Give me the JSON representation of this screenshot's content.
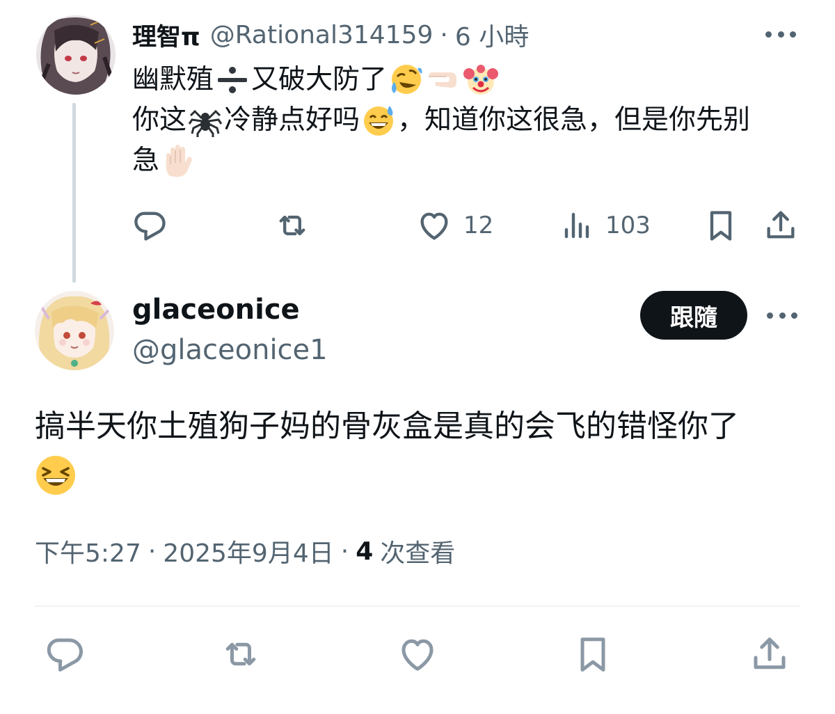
{
  "reply_tweet": {
    "display_name": "理智π",
    "handle": "@Rational314159",
    "separator": "·",
    "time": "6 小時",
    "line1_a": "幽默殖",
    "line1_b": "又破大防了",
    "line2_a": "你这",
    "line2_b": "冷静点好吗",
    "line2_c": "，知道你这很急，但是你先别",
    "line3_a": "急",
    "emoji_names": [
      "divide-emoji",
      "rofl-emoji",
      "pointing-left-emoji",
      "clown-emoji",
      "spider-emoji",
      "grinning-sweat-emoji",
      "raised-hand-emoji"
    ],
    "actions": {
      "likes": "12",
      "views": "103"
    }
  },
  "main_tweet": {
    "display_name": "glaceonice",
    "handle": "@glaceonice1",
    "follow_label": "跟隨",
    "line1": "搞半天你土殖狗子妈的骨灰盒是真的会飞的错怪你了",
    "emoji_name": "laughing-emoji",
    "time": "下午5:27",
    "separator": "·",
    "date": "2025年9月4日",
    "separator2": "·",
    "views_count": "4",
    "views_label": "次查看"
  },
  "icons": [
    "reply-icon",
    "retweet-icon",
    "like-icon",
    "views-icon",
    "bookmark-icon",
    "share-icon",
    "more-icon"
  ],
  "colors": {
    "text_primary": "#0f1419",
    "text_secondary": "#536471",
    "thread_line": "#cfd9de",
    "follow_bg": "#0f1419",
    "follow_text": "#ffffff",
    "bottom_icons": "#8b98a5"
  }
}
